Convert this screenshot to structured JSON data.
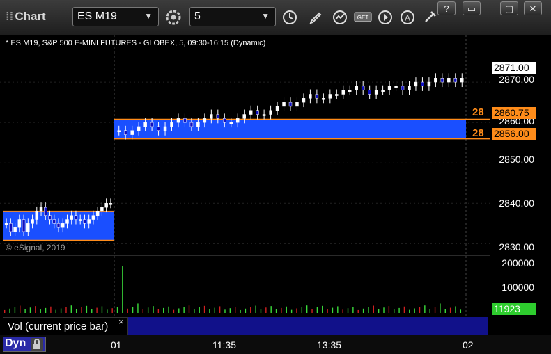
{
  "window": {
    "title": "Chart",
    "controls": [
      "?",
      "▭",
      "▢",
      "✕"
    ]
  },
  "toolbar": {
    "symbol": "ES M19",
    "interval": "5"
  },
  "chart": {
    "legend": "* ES M19, S&P 500 E-MINI FUTURES - GLOBEX, 5, 09:30-16:15 (Dynamic)",
    "watermark": "© eSignal, 2019",
    "price_axis": [
      "2870.00",
      "2860.00",
      "2850.00",
      "2840.00",
      "2830.00"
    ],
    "volume_axis": [
      "200000",
      "100000"
    ],
    "last_price": "2871.00",
    "zone_upper": "2860.75",
    "zone_lower": "2856.00",
    "zone_upper_label": "28",
    "zone_lower_label": "28",
    "last_volume": "11923",
    "time_axis": [
      "01",
      "11:35",
      "13:35",
      "02"
    ]
  },
  "volume_panel": {
    "title": "Vol (current price bar)",
    "close": "×"
  },
  "status": {
    "mode": "Dyn"
  },
  "colors": {
    "zone_fill": "#1a4fff",
    "zone_line": "#ff8c1a",
    "vol_up": "#3adb3a",
    "vol_down": "#d32020",
    "last_volume_bg": "#2ecc2e"
  },
  "chart_data": {
    "type": "candlestick",
    "price_ylim": [
      2828,
      2880
    ],
    "volume_ylim": [
      0,
      230000
    ],
    "zones": [
      {
        "upper": 2860.75,
        "lower": 2856.0,
        "session": "current"
      },
      {
        "upper": 2838.0,
        "lower": 2830.8,
        "session": "previous"
      }
    ],
    "prev_session_closes": [
      2835,
      2833,
      2834,
      2836,
      2833,
      2835,
      2836,
      2838,
      2839,
      2837,
      2836,
      2835,
      2834,
      2835,
      2836,
      2837,
      2836,
      2836,
      2835,
      2836,
      2837,
      2838,
      2839,
      2840,
      2840
    ],
    "session_closes": [
      2858,
      2857,
      2858,
      2859,
      2860,
      2859,
      2858,
      2859,
      2860,
      2861,
      2860,
      2859,
      2860,
      2861,
      2862,
      2861,
      2860,
      2860,
      2861,
      2862,
      2863,
      2862,
      2862,
      2863,
      2864,
      2865,
      2864,
      2865,
      2866,
      2867,
      2866,
      2866,
      2867,
      2867,
      2868,
      2868,
      2869,
      2868,
      2867,
      2868,
      2868,
      2869,
      2869,
      2868,
      2869,
      2870,
      2869,
      2870,
      2871,
      2870,
      2871,
      2870,
      2871
    ],
    "volume_spike": 200000
  }
}
